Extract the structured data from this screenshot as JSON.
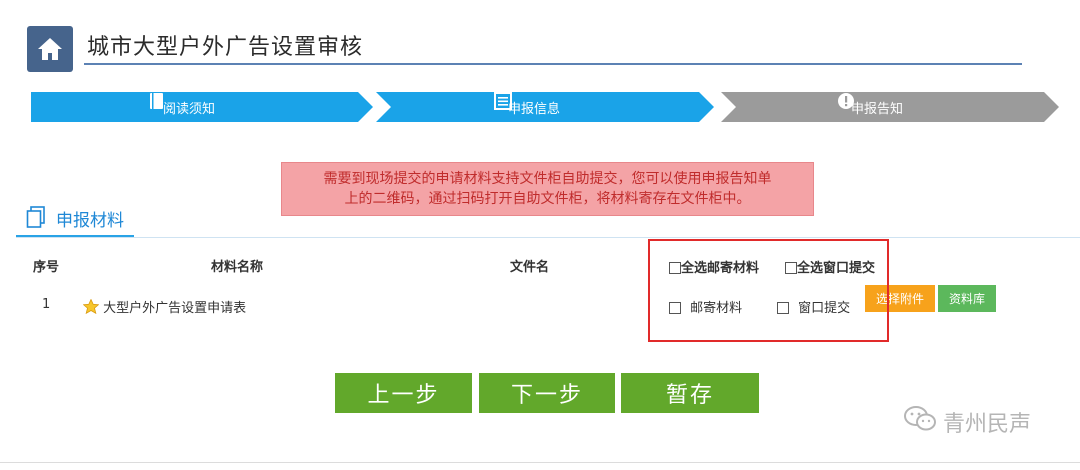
{
  "header": {
    "title": "城市大型户外广告设置审核"
  },
  "steps": [
    {
      "label": "阅读须知",
      "icon": "book-icon",
      "color": "#1aa3e8"
    },
    {
      "label": "申报信息",
      "icon": "list-icon",
      "color": "#1aa3e8"
    },
    {
      "label": "申报告知",
      "icon": "alert-icon",
      "color": "#9b9b9b"
    }
  ],
  "notice": {
    "line1": "需要到现场提交的申请材料支持文件柜自助提交，您可以使用申报告知单",
    "line2": "上的二维码，通过扫码打开自助文件柜，将材料寄存在文件柜中。"
  },
  "section": {
    "title": "申报材料"
  },
  "table": {
    "headers": {
      "index": "序号",
      "name": "材料名称",
      "file": "文件名"
    },
    "select_all_mail": "全选邮寄材料",
    "select_all_window": "全选窗口提交",
    "rows": [
      {
        "index": "1",
        "name": "大型户外广告设置申请表",
        "mail_label": "邮寄材料",
        "window_label": "窗口提交",
        "select_button": "选择附件",
        "library_button": "资料库"
      }
    ]
  },
  "buttons": {
    "prev": "上一步",
    "next": "下一步",
    "save": "暂存"
  },
  "watermark": {
    "text": "青州民声"
  },
  "colors": {
    "accent": "#1aa3e8",
    "primary_green": "#62a82b",
    "orange": "#f7a21b",
    "light_green": "#5cb85c",
    "highlight_red": "#e12a2a"
  }
}
